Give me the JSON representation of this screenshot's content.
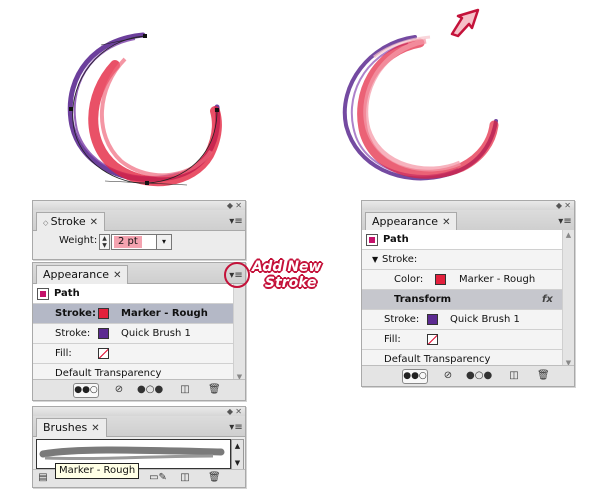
{
  "colors": {
    "stroke_red": "#e3203c",
    "stroke_purple": "#5c2a91",
    "selected_row": "#b4b8c6",
    "transform_row": "#c6c7cd",
    "annotation_red": "#c4123a"
  },
  "left_artwork": {
    "anchor_points": true
  },
  "stroke_panel": {
    "tab_label": "Stroke",
    "weight_label": "Weight:",
    "weight_value": "2 pt"
  },
  "appearance_left": {
    "tab_label": "Appearance",
    "header": "Path",
    "rows": [
      {
        "label": "Stroke:",
        "swatch": "red",
        "value": "Marker - Rough"
      },
      {
        "label": "Stroke:",
        "swatch": "purple",
        "value": "Quick Brush 1"
      },
      {
        "label": "Fill:",
        "swatch": "none",
        "value": ""
      },
      {
        "label": "Default Transparency"
      }
    ]
  },
  "annotation": {
    "line1": "Add New",
    "line2": "Stroke"
  },
  "brushes_panel": {
    "tab_label": "Brushes",
    "tooltip": "Marker - Rough"
  },
  "appearance_right": {
    "tab_label": "Appearance",
    "header": "Path",
    "stroke_group_label": "Stroke:",
    "color_label": "Color:",
    "color_value": "Marker - Rough",
    "transform_label": "Transform",
    "fx_label": "fx",
    "stroke_label": "Stroke:",
    "stroke_value": "Quick Brush 1",
    "fill_label": "Fill:",
    "transparency_label": "Default Transparency"
  },
  "icons": [
    "close-icon",
    "panel-menu-icon",
    "new-art-icon",
    "clear-appearance-icon",
    "reduce-appearance-icon",
    "duplicate-item-icon",
    "delete-icon",
    "arrow-icon",
    "fx-icon"
  ]
}
